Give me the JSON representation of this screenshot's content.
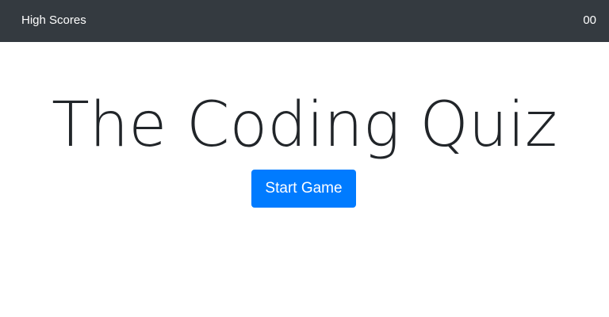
{
  "navbar": {
    "high_scores_label": "High Scores",
    "timer_value": "00",
    "background_color": "#343a40"
  },
  "main": {
    "title": "The Coding Quiz",
    "start_button_label": "Start Game",
    "button_color": "#007bff"
  }
}
